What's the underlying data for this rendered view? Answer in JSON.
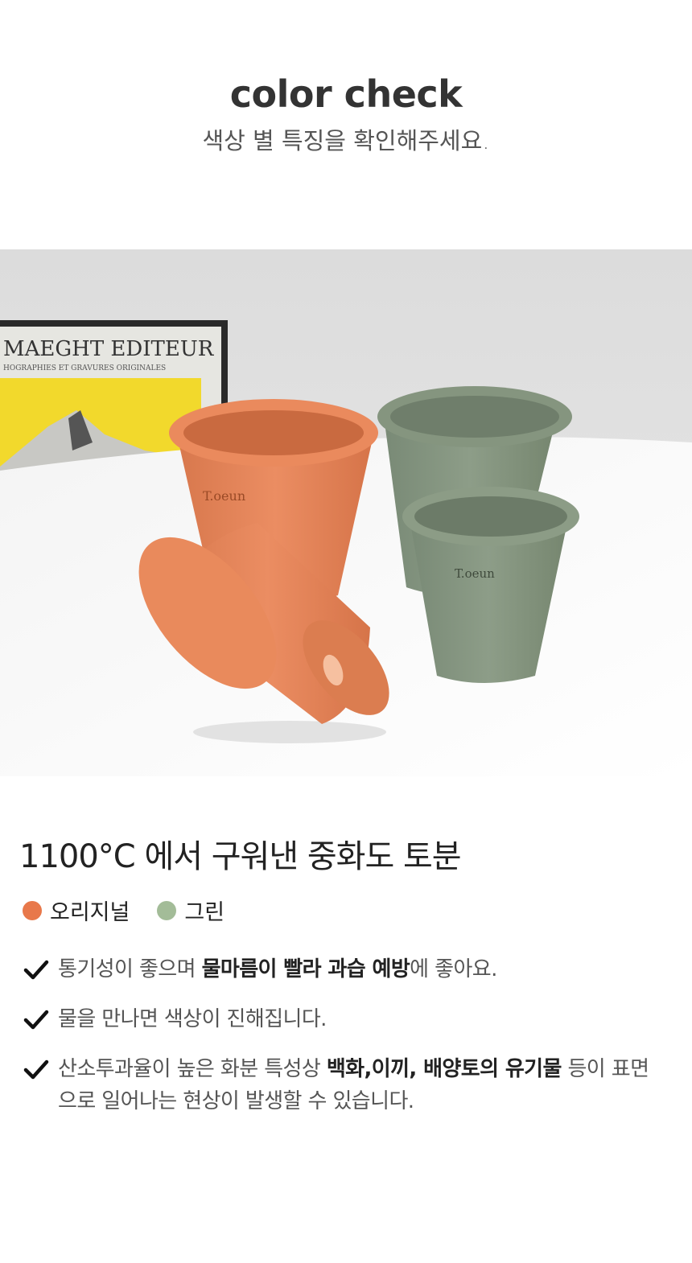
{
  "header": {
    "title": "color check",
    "subtitle": "색상 별 특징을 확인해주세요."
  },
  "photo": {
    "poster_title": "MAEGHT EDITEUR",
    "poster_subtitle": "HOGRAPHIES ET GRAVURES ORIGINALES",
    "pot_brand": "T.oeun"
  },
  "content": {
    "heading": "1100°C 에서 구워낸 중화도 토분",
    "colors": [
      {
        "label": "오리지널",
        "color": "#e8784a"
      },
      {
        "label": "그린",
        "color": "#a3bc98"
      }
    ],
    "features": [
      {
        "pre": "통기성이 좋으며 ",
        "bold": "물마름이 빨라 과습 예방",
        "post": "에 좋아요."
      },
      {
        "pre": "물을 만나면 색상이 진해집니다.",
        "bold": "",
        "post": ""
      },
      {
        "pre": "산소투과율이 높은 화분 특성상 ",
        "bold": "백화,이끼, 배양토의 유기물",
        "post": " 등이 표면으로 일어나는 현상이 발생할 수 있습니다."
      }
    ]
  }
}
